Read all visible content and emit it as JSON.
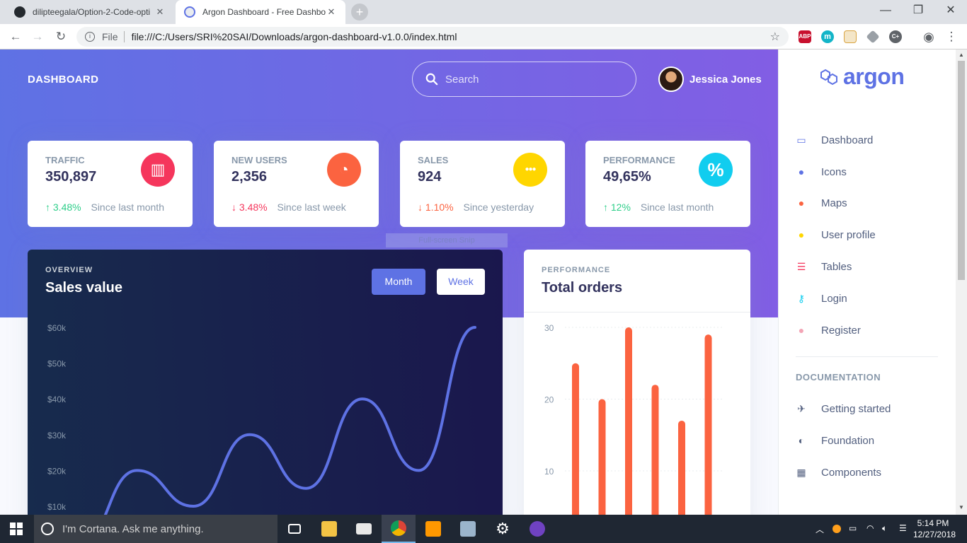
{
  "browser": {
    "tabs": [
      {
        "title": "dilipteegala/Option-2-Code-opti",
        "active": false
      },
      {
        "title": "Argon Dashboard - Free Dashbo",
        "active": true
      }
    ],
    "new_tab": "+",
    "window_controls": {
      "minimize": "—",
      "restore": "❐",
      "close": "✕"
    },
    "nav": {
      "back": "←",
      "forward": "→",
      "reload": "↻"
    },
    "url_scheme_label": "File",
    "url": "file:///C:/Users/SRI%20SAI/Downloads/argon-dashboard-v1.0.0/index.html",
    "extensions": [
      "ABP",
      "m",
      "",
      "",
      "C+"
    ]
  },
  "header": {
    "title": "DASHBOARD",
    "search_placeholder": "Search",
    "user_name": "Jessica Jones"
  },
  "stats": [
    {
      "label": "TRAFFIC",
      "value": "350,897",
      "delta": "3.48%",
      "direction": "up",
      "since": "Since last month",
      "icon": "chart-bar-icon",
      "color": "#f5365c",
      "glyph": "▥"
    },
    {
      "label": "NEW USERS",
      "value": "2,356",
      "delta": "3.48%",
      "direction": "down",
      "since": "Since last week",
      "icon": "chart-pie-icon",
      "color": "#fb6340",
      "glyph": "◔"
    },
    {
      "label": "SALES",
      "value": "924",
      "delta": "1.10%",
      "direction": "down",
      "since": "Since yesterday",
      "icon": "users-icon",
      "color": "#ffd600",
      "glyph": "●●●"
    },
    {
      "label": "PERFORMANCE",
      "value": "49,65%",
      "delta": "12%",
      "direction": "up",
      "since": "Since last month",
      "icon": "percent-icon",
      "color": "#11cdef",
      "glyph": "%"
    }
  ],
  "overlay": {
    "snip": "Full-screen Snip"
  },
  "sales_card": {
    "eyebrow": "OVERVIEW",
    "title": "Sales value",
    "btn_month": "Month",
    "btn_week": "Week"
  },
  "orders_card": {
    "eyebrow": "PERFORMANCE",
    "title": "Total orders"
  },
  "chart_data": [
    {
      "type": "line",
      "title": "Sales value",
      "y_tick_labels": [
        "$60k",
        "$50k",
        "$40k",
        "$30k",
        "$20k",
        "$10k"
      ],
      "ylim": [
        0,
        60
      ],
      "values": [
        0,
        20,
        10,
        30,
        15,
        40,
        20,
        60
      ],
      "grid": false,
      "color": "#5e72e4"
    },
    {
      "type": "bar",
      "title": "Total orders",
      "y_tick_labels": [
        "30",
        "20",
        "10"
      ],
      "ylim": [
        0,
        30
      ],
      "values": [
        25,
        20,
        30,
        22,
        17,
        29
      ],
      "grid": true,
      "color": "#fb6340"
    }
  ],
  "sidebar": {
    "brand": "argon",
    "items": [
      {
        "label": "Dashboard",
        "icon": "tv-icon",
        "color": "#5e72e4",
        "glyph": "▭"
      },
      {
        "label": "Icons",
        "icon": "planet-icon",
        "color": "#5e72e4",
        "glyph": "●"
      },
      {
        "label": "Maps",
        "icon": "pin-icon",
        "color": "#fb6340",
        "glyph": "●"
      },
      {
        "label": "User profile",
        "icon": "user-icon",
        "color": "#ffd600",
        "glyph": "●"
      },
      {
        "label": "Tables",
        "icon": "bullet-list-icon",
        "color": "#f5365c",
        "glyph": "☰"
      },
      {
        "label": "Login",
        "icon": "key-icon",
        "color": "#11cdef",
        "glyph": "⚷"
      },
      {
        "label": "Register",
        "icon": "circle-user-icon",
        "color": "#f3a4b5",
        "glyph": "●"
      }
    ],
    "doc_heading": "DOCUMENTATION",
    "doc_items": [
      {
        "label": "Getting started",
        "icon": "spaceship-icon",
        "glyph": "✈"
      },
      {
        "label": "Foundation",
        "icon": "palette-icon",
        "glyph": "◐"
      },
      {
        "label": "Components",
        "icon": "components-icon",
        "glyph": "▦"
      }
    ]
  },
  "taskbar": {
    "cortana": "I'm Cortana. Ask me anything.",
    "time": "5:14 PM",
    "date": "12/27/2018"
  }
}
